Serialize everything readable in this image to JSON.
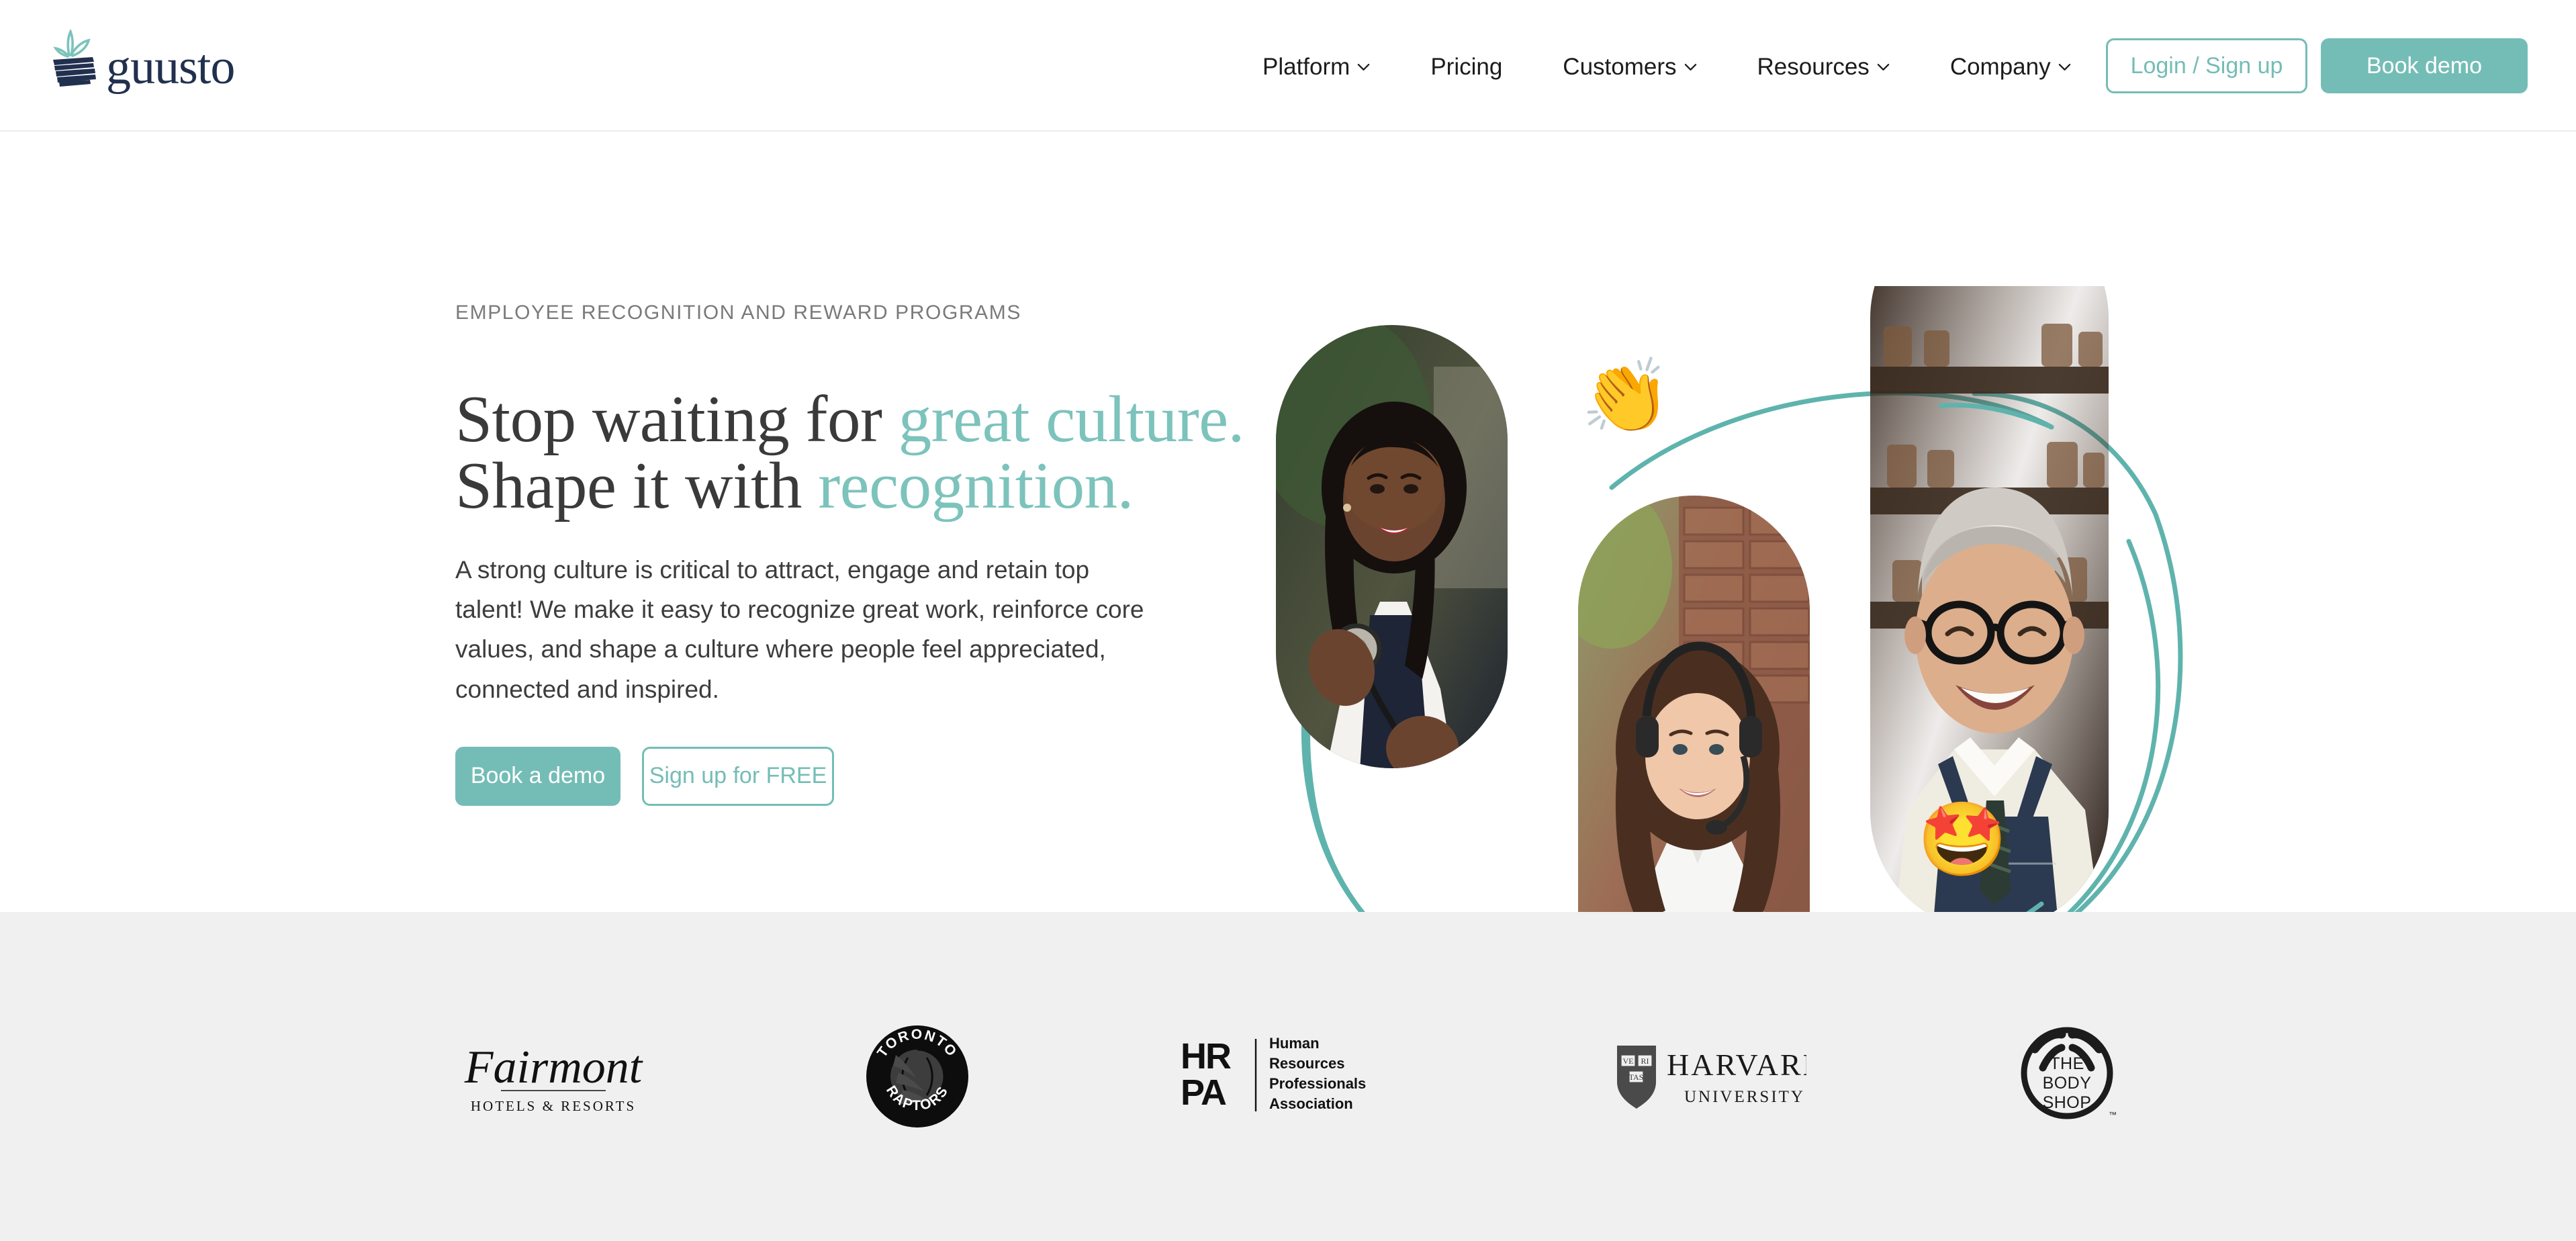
{
  "brand": {
    "name": "guusto",
    "mark_icon": "gift-box-sprout-icon"
  },
  "header": {
    "nav": [
      {
        "label": "Platform",
        "has_dropdown": true
      },
      {
        "label": "Pricing",
        "has_dropdown": false
      },
      {
        "label": "Customers",
        "has_dropdown": true
      },
      {
        "label": "Resources",
        "has_dropdown": true
      },
      {
        "label": "Company",
        "has_dropdown": true
      }
    ],
    "login_label": "Login / Sign up",
    "demo_label": "Book demo"
  },
  "hero": {
    "eyebrow": "EMPLOYEE RECOGNITION AND REWARD PROGRAMS",
    "headline_line1_plain": "Stop waiting for ",
    "headline_line1_accent": "great culture.",
    "headline_line2_plain": "Shape it with ",
    "headline_line2_accent": "recognition.",
    "body": "A strong culture is critical to attract, engage and retain top talent! We make it easy to recognize great work, reinforce core values, and shape a culture where people feel appreciated, connected and inspired.",
    "cta_primary": "Book a demo",
    "cta_secondary": "Sign up for FREE",
    "art": {
      "photos": [
        {
          "name": "photo-doctor-stethoscope",
          "alt": "Smiling woman in lab coat holding a stethoscope"
        },
        {
          "name": "photo-call-center-agent",
          "alt": "Smiling woman wearing a headset"
        },
        {
          "name": "photo-shop-owner",
          "alt": "Smiling older man in glasses and apron"
        }
      ],
      "emojis": [
        {
          "name": "clapping-hands-emoji",
          "glyph": "👏"
        },
        {
          "name": "star-struck-emoji",
          "glyph": "🤩"
        }
      ],
      "swirl_color": "#5fb3ad"
    }
  },
  "logo_strip": {
    "logos": [
      {
        "name": "fairmont-logo",
        "primary": "Fairmont",
        "secondary": "HOTELS & RESORTS"
      },
      {
        "name": "toronto-raptors-logo",
        "primary": "TORONTO",
        "secondary": "RAPTORS"
      },
      {
        "name": "hrpa-logo",
        "primary": "HRPA",
        "secondary": "Human Resources Professionals Association"
      },
      {
        "name": "harvard-logo",
        "primary": "HARVARD",
        "secondary": "UNIVERSITY"
      },
      {
        "name": "body-shop-logo",
        "primary": "THE BODY SHOP",
        "secondary": "™"
      }
    ]
  },
  "colors": {
    "teal": "#74bdb6",
    "teal_headline": "#7cc3bc",
    "navy": "#22304f",
    "text_dark": "#3a3a3a",
    "eyebrow_grey": "#7a7a7a",
    "strip_bg": "#f0f0f0"
  }
}
